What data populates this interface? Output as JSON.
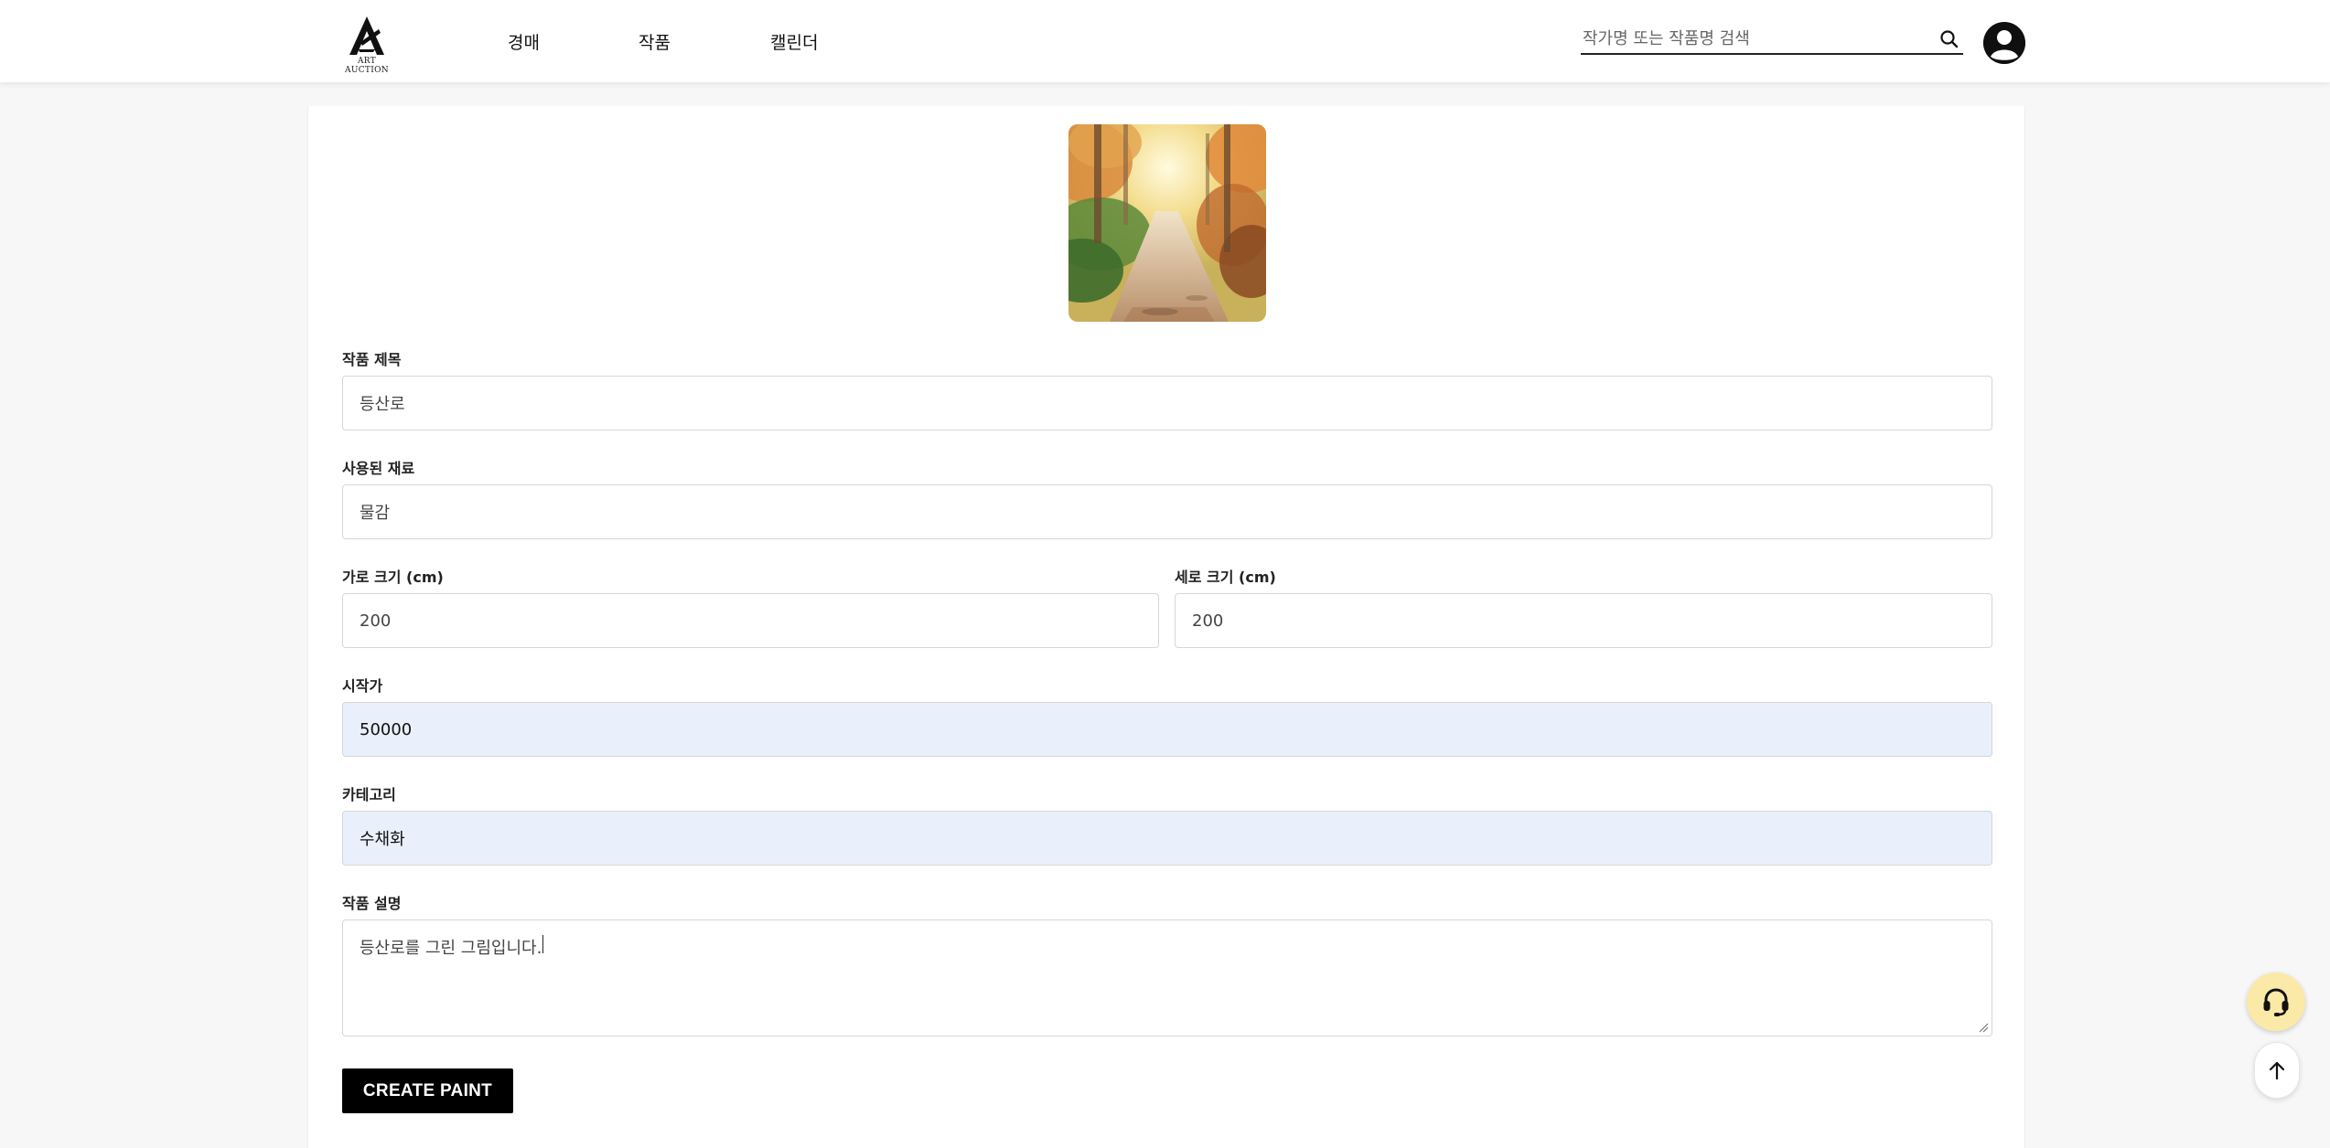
{
  "header": {
    "logo_text": "ART AUCTION",
    "nav": [
      {
        "label": "경매"
      },
      {
        "label": "작품"
      },
      {
        "label": "캘린더"
      }
    ],
    "search_placeholder": "작가명 또는 작품명 검색",
    "search_icon": "search-icon",
    "avatar_icon": "user-icon"
  },
  "form": {
    "title_label": "작품 제목",
    "title_value": "등산로",
    "material_label": "사용된 재료",
    "material_value": "물감",
    "width_label": "가로 크기 (cm)",
    "width_value": "200",
    "height_label": "세로 크기 (cm)",
    "height_value": "200",
    "price_label": "시작가",
    "price_value": "50000",
    "category_label": "카테고리",
    "category_value": "수채화",
    "description_label": "작품 설명",
    "description_value": "등산로를 그린 그림입니다.",
    "submit_label": "CREATE PAINT"
  },
  "colors": {
    "accent": "#000000",
    "autofill": "#e9f0fc",
    "support_fab": "#fbe9a8"
  },
  "floating": {
    "support_icon": "headset-icon",
    "top_icon": "arrow-up-icon"
  }
}
